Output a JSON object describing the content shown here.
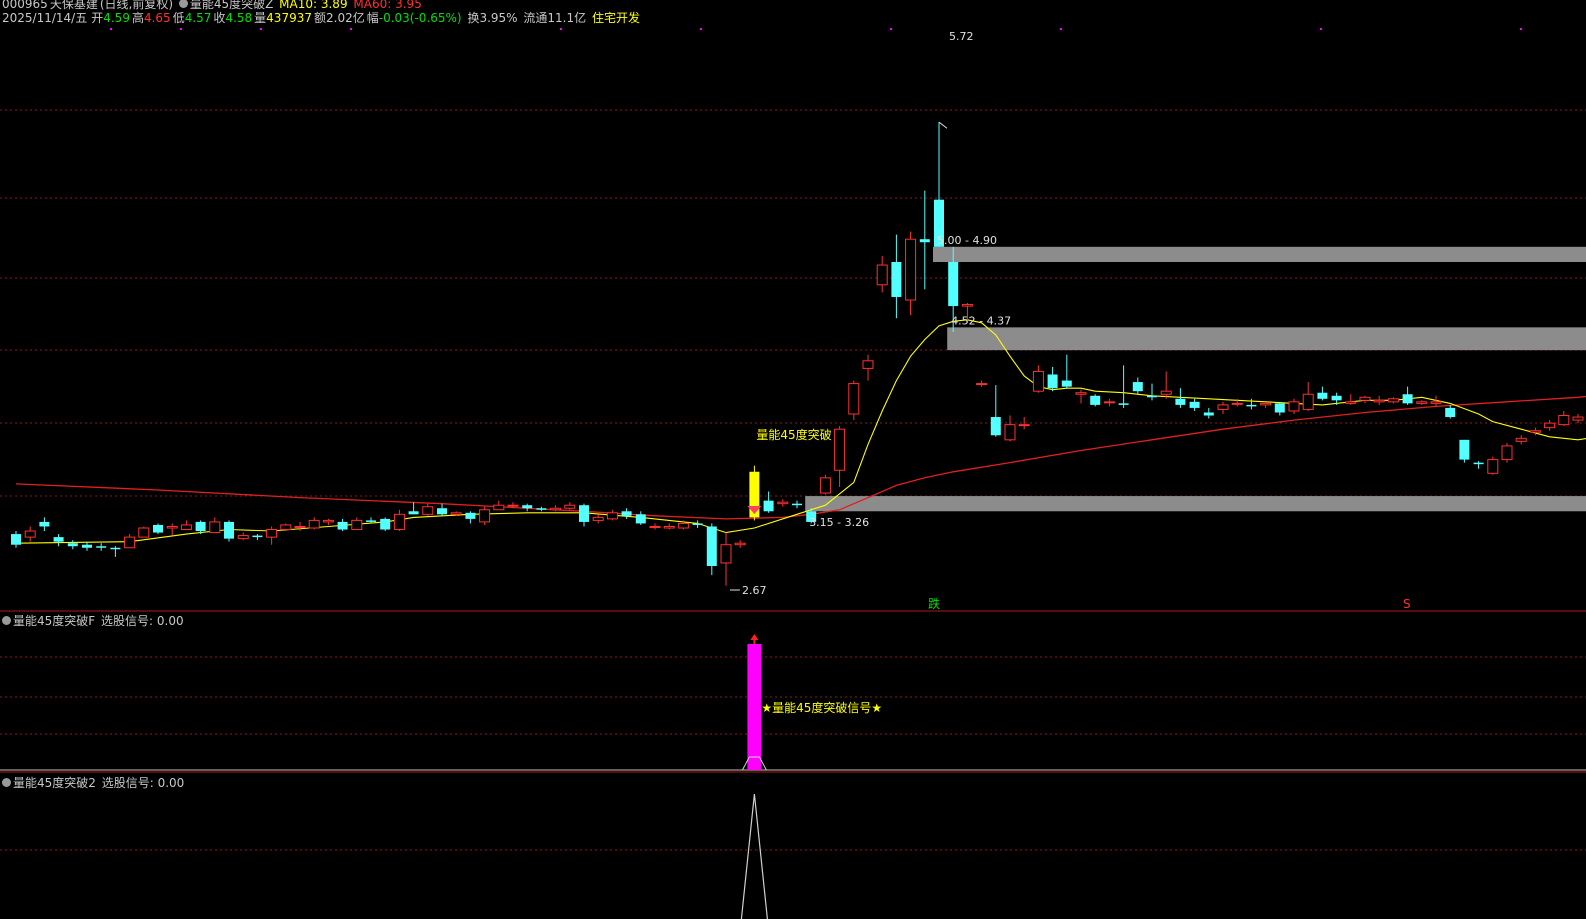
{
  "header": {
    "code": "000965",
    "name": "天保基建",
    "period": "(日线,前复权)",
    "indicator": "量能45度突破Z",
    "ma10_label": "MA10: 3.89",
    "ma60_label": "MA60: 3.95",
    "date": "2025/11/14/五",
    "open_label": "开",
    "open_value": "4.59",
    "high_label": "高",
    "high_value": "4.65",
    "low_label": "低",
    "low_value": "4.57",
    "close_label": "收",
    "close_value": "4.58",
    "volume_label": "量",
    "volume_value": "437937",
    "amount_label": "额",
    "amount_value": "2.02亿",
    "change_label": "幅",
    "change_value": "-0.03(-0.65%)",
    "turnover": "换3.95%",
    "float_cap": "流通11.1亿",
    "sector": "住宅开发"
  },
  "colors": {
    "up": "#ff3030",
    "down": "#54ffff",
    "ma10": "#ffff00",
    "ma60": "#e02020",
    "zone": "#8c8c8c",
    "grid": "#8b1a1a",
    "signal": "#ff00ff",
    "text_yellow": "#ffff00"
  },
  "panel1": {
    "title": "量能45度突破F",
    "signal_label": "选股信号: 0.00",
    "annotation": "★量能45度突破信号★"
  },
  "panel2": {
    "title": "量能45度突破2",
    "signal_label": "选股信号: 0.00"
  },
  "chart_data": {
    "type": "candlestick",
    "ylim": [
      2.5,
      5.8
    ],
    "max_label": "5.72",
    "min_label": "2.67",
    "breakout_label": "量能45度突破",
    "fall_label": "跌",
    "s_label": "S",
    "zones": [
      {
        "label": "5.00 - 4.90",
        "high": 4.9,
        "low": 4.8,
        "start": 65
      },
      {
        "label": "4.52 - 4.37",
        "high": 4.37,
        "low": 4.22,
        "start": 66
      },
      {
        "label": "3.15 - 3.26",
        "high": 3.26,
        "low": 3.16,
        "start": 56
      }
    ],
    "candles": [
      [
        3.01,
        2.94,
        3.03,
        2.92
      ],
      [
        2.99,
        3.03,
        3.06,
        2.96
      ],
      [
        3.09,
        3.06,
        3.12,
        3.03
      ],
      [
        2.99,
        2.96,
        3.01,
        2.93
      ],
      [
        2.95,
        2.93,
        2.97,
        2.91
      ],
      [
        2.94,
        2.92,
        2.96,
        2.9
      ],
      [
        2.93,
        2.92,
        2.95,
        2.9
      ],
      [
        2.92,
        2.91,
        2.93,
        2.86
      ],
      [
        2.92,
        2.99,
        3.01,
        2.92
      ],
      [
        2.99,
        3.05,
        3.06,
        2.99
      ],
      [
        3.07,
        3.02,
        3.08,
        3.01
      ],
      [
        3.05,
        3.06,
        3.08,
        3.0
      ],
      [
        3.04,
        3.07,
        3.1,
        3.04
      ],
      [
        3.09,
        3.03,
        3.1,
        3.01
      ],
      [
        3.02,
        3.09,
        3.12,
        3.02
      ],
      [
        3.09,
        2.98,
        3.1,
        2.96
      ],
      [
        2.98,
        3.0,
        3.02,
        2.97
      ],
      [
        3.0,
        2.99,
        3.01,
        2.97
      ],
      [
        2.99,
        3.04,
        3.06,
        2.94
      ],
      [
        3.04,
        3.07,
        3.08,
        3.03
      ],
      [
        3.06,
        3.06,
        3.09,
        3.03
      ],
      [
        3.05,
        3.1,
        3.12,
        3.04
      ],
      [
        3.09,
        3.1,
        3.11,
        3.07
      ],
      [
        3.09,
        3.04,
        3.11,
        3.03
      ],
      [
        3.04,
        3.1,
        3.12,
        3.04
      ],
      [
        3.1,
        3.09,
        3.12,
        3.08
      ],
      [
        3.11,
        3.04,
        3.12,
        3.03
      ],
      [
        3.04,
        3.14,
        3.17,
        3.03
      ],
      [
        3.16,
        3.14,
        3.22,
        3.14
      ],
      [
        3.14,
        3.19,
        3.21,
        3.13
      ],
      [
        3.18,
        3.14,
        3.21,
        3.13
      ],
      [
        3.14,
        3.15,
        3.16,
        3.13
      ],
      [
        3.15,
        3.11,
        3.16,
        3.08
      ],
      [
        3.09,
        3.17,
        3.19,
        3.07
      ],
      [
        3.17,
        3.2,
        3.23,
        3.17
      ],
      [
        3.2,
        3.2,
        3.22,
        3.18
      ],
      [
        3.2,
        3.18,
        3.21,
        3.16
      ],
      [
        3.18,
        3.17,
        3.19,
        3.16
      ],
      [
        3.17,
        3.18,
        3.2,
        3.16
      ],
      [
        3.18,
        3.2,
        3.22,
        3.17
      ],
      [
        3.2,
        3.09,
        3.21,
        3.06
      ],
      [
        3.1,
        3.12,
        3.14,
        3.08
      ],
      [
        3.11,
        3.15,
        3.17,
        3.1
      ],
      [
        3.16,
        3.13,
        3.18,
        3.11
      ],
      [
        3.14,
        3.08,
        3.16,
        3.07
      ],
      [
        3.06,
        3.06,
        3.08,
        3.04
      ],
      [
        3.05,
        3.06,
        3.08,
        3.04
      ],
      [
        3.05,
        3.08,
        3.1,
        3.04
      ],
      [
        3.08,
        3.07,
        3.1,
        3.05
      ],
      [
        3.06,
        2.8,
        3.08,
        2.74
      ],
      [
        2.82,
        2.94,
        3.02,
        2.67
      ],
      [
        2.94,
        2.95,
        2.97,
        2.92
      ],
      [
        3.12,
        3.42,
        3.46,
        3.1
      ],
      [
        3.23,
        3.16,
        3.29,
        3.15
      ],
      [
        3.21,
        3.22,
        3.24,
        3.19
      ],
      [
        3.21,
        3.2,
        3.23,
        3.18
      ],
      [
        3.16,
        3.09,
        3.18,
        3.08
      ],
      [
        3.28,
        3.38,
        3.4,
        3.27
      ],
      [
        3.43,
        3.7,
        3.72,
        3.32
      ],
      [
        3.8,
        4.0,
        4.02,
        3.76
      ],
      [
        4.1,
        4.15,
        4.19,
        4.02
      ],
      [
        4.65,
        4.78,
        4.84,
        4.6
      ],
      [
        4.8,
        4.57,
        4.98,
        4.43
      ],
      [
        4.55,
        4.95,
        5.0,
        4.45
      ],
      [
        4.95,
        4.93,
        5.27,
        4.62
      ],
      [
        5.21,
        4.9,
        5.72,
        4.9
      ],
      [
        4.8,
        4.51,
        4.9,
        4.34
      ],
      [
        4.51,
        4.52,
        4.53,
        4.4
      ],
      [
        4.0,
        4.0,
        4.02,
        3.98
      ],
      [
        3.78,
        3.66,
        3.99,
        3.65
      ],
      [
        3.63,
        3.73,
        3.79,
        3.62
      ],
      [
        3.73,
        3.73,
        3.78,
        3.7
      ],
      [
        3.95,
        4.08,
        4.12,
        3.94
      ],
      [
        4.06,
        3.97,
        4.11,
        3.95
      ],
      [
        4.02,
        3.98,
        4.19,
        3.97
      ],
      [
        3.93,
        3.94,
        3.96,
        3.87
      ],
      [
        3.92,
        3.86,
        3.93,
        3.85
      ],
      [
        3.88,
        3.88,
        3.9,
        3.85
      ],
      [
        3.87,
        3.86,
        4.12,
        3.84
      ],
      [
        4.01,
        3.95,
        4.04,
        3.93
      ],
      [
        3.92,
        3.91,
        4.0,
        3.89
      ],
      [
        3.93,
        3.95,
        4.08,
        3.9
      ],
      [
        3.9,
        3.86,
        3.97,
        3.84
      ],
      [
        3.88,
        3.84,
        3.9,
        3.82
      ],
      [
        3.81,
        3.79,
        3.84,
        3.77
      ],
      [
        3.83,
        3.86,
        3.88,
        3.8
      ],
      [
        3.87,
        3.87,
        3.9,
        3.85
      ],
      [
        3.86,
        3.85,
        3.9,
        3.83
      ],
      [
        3.86,
        3.87,
        3.87,
        3.84
      ],
      [
        3.87,
        3.81,
        3.88,
        3.79
      ],
      [
        3.82,
        3.88,
        3.9,
        3.8
      ],
      [
        3.83,
        3.93,
        4.01,
        3.82
      ],
      [
        3.94,
        3.9,
        3.98,
        3.89
      ],
      [
        3.92,
        3.89,
        3.94,
        3.86
      ],
      [
        3.87,
        3.88,
        3.93,
        3.86
      ],
      [
        3.89,
        3.91,
        3.92,
        3.87
      ],
      [
        3.88,
        3.89,
        3.92,
        3.86
      ],
      [
        3.88,
        3.9,
        3.91,
        3.87
      ],
      [
        3.93,
        3.87,
        3.98,
        3.86
      ],
      [
        3.87,
        3.88,
        3.89,
        3.86
      ],
      [
        3.87,
        3.88,
        3.92,
        3.85
      ],
      [
        3.84,
        3.78,
        3.86,
        3.77
      ],
      [
        3.63,
        3.5,
        3.63,
        3.48
      ],
      [
        3.48,
        3.47,
        3.49,
        3.44
      ],
      [
        3.41,
        3.5,
        3.52,
        3.4
      ],
      [
        3.5,
        3.59,
        3.61,
        3.48
      ],
      [
        3.62,
        3.64,
        3.66,
        3.6
      ],
      [
        3.68,
        3.69,
        3.71,
        3.66
      ],
      [
        3.71,
        3.74,
        3.76,
        3.69
      ],
      [
        3.73,
        3.79,
        3.82,
        3.72
      ],
      [
        3.76,
        3.78,
        3.8,
        3.74
      ],
      [
        3.77,
        3.77,
        3.78,
        3.76
      ],
      [
        3.78,
        3.8,
        3.84,
        3.77
      ],
      [
        3.82,
        3.85,
        3.86,
        3.81
      ],
      [
        3.86,
        3.81,
        3.87,
        3.79
      ]
    ],
    "ma10": [
      [
        0,
        2.95
      ],
      [
        8,
        2.96
      ],
      [
        12,
        3.01
      ],
      [
        15,
        3.04
      ],
      [
        18,
        3.03
      ],
      [
        22,
        3.06
      ],
      [
        26,
        3.09
      ],
      [
        28,
        3.12
      ],
      [
        32,
        3.14
      ],
      [
        36,
        3.15
      ],
      [
        40,
        3.15
      ],
      [
        44,
        3.12
      ],
      [
        48,
        3.08
      ],
      [
        50,
        3.02
      ],
      [
        52,
        3.05
      ],
      [
        55,
        3.14
      ],
      [
        57,
        3.2
      ],
      [
        59,
        3.35
      ],
      [
        60,
        3.6
      ],
      [
        61,
        3.82
      ],
      [
        62,
        4.02
      ],
      [
        63,
        4.18
      ],
      [
        64,
        4.29
      ],
      [
        65,
        4.38
      ],
      [
        66,
        4.41
      ],
      [
        67,
        4.42
      ],
      [
        68,
        4.4
      ],
      [
        69,
        4.32
      ],
      [
        70,
        4.18
      ],
      [
        71,
        4.05
      ],
      [
        72,
        3.98
      ],
      [
        73,
        3.96
      ],
      [
        74,
        3.97
      ],
      [
        75,
        3.97
      ],
      [
        76,
        3.95
      ],
      [
        78,
        3.94
      ],
      [
        80,
        3.92
      ],
      [
        82,
        3.91
      ],
      [
        84,
        3.9
      ],
      [
        86,
        3.89
      ],
      [
        88,
        3.88
      ],
      [
        90,
        3.87
      ],
      [
        92,
        3.86
      ],
      [
        95,
        3.89
      ],
      [
        97,
        3.89
      ],
      [
        99,
        3.91
      ],
      [
        101,
        3.87
      ],
      [
        103,
        3.8
      ],
      [
        104,
        3.75
      ],
      [
        106,
        3.7
      ],
      [
        108,
        3.65
      ],
      [
        110,
        3.63
      ],
      [
        112,
        3.66
      ],
      [
        113,
        3.7
      ],
      [
        114,
        3.75
      ]
    ],
    "ma60": [
      [
        0,
        3.34
      ],
      [
        10,
        3.3
      ],
      [
        20,
        3.25
      ],
      [
        30,
        3.21
      ],
      [
        40,
        3.16
      ],
      [
        45,
        3.13
      ],
      [
        50,
        3.11
      ],
      [
        54,
        3.12
      ],
      [
        56,
        3.14
      ],
      [
        58,
        3.17
      ],
      [
        60,
        3.25
      ],
      [
        62,
        3.33
      ],
      [
        64,
        3.38
      ],
      [
        66,
        3.42
      ],
      [
        70,
        3.48
      ],
      [
        75,
        3.56
      ],
      [
        80,
        3.63
      ],
      [
        85,
        3.7
      ],
      [
        90,
        3.76
      ],
      [
        95,
        3.81
      ],
      [
        100,
        3.85
      ],
      [
        105,
        3.88
      ],
      [
        110,
        3.91
      ],
      [
        114,
        3.95
      ]
    ],
    "signal_index": 52,
    "panel1_range": [
      0,
      1
    ],
    "panel1_values": {
      "index": 52,
      "value": 1
    },
    "panel2_range": [
      0,
      1
    ],
    "panel2_values": {
      "index": 52,
      "value": 1
    }
  }
}
